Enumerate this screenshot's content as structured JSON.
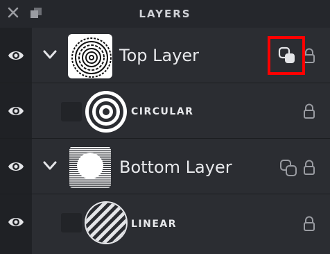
{
  "header": {
    "title": "LAYERS"
  },
  "layers": [
    {
      "name": "Top Layer"
    },
    {
      "name": "CIRCULAR"
    },
    {
      "name": "Bottom Layer"
    },
    {
      "name": "LINEAR"
    }
  ],
  "colors": {
    "highlight": "#ff0000",
    "panel_bg": "#25272c",
    "row_bg": "#2b2d32",
    "text": "#e8e9ec"
  }
}
